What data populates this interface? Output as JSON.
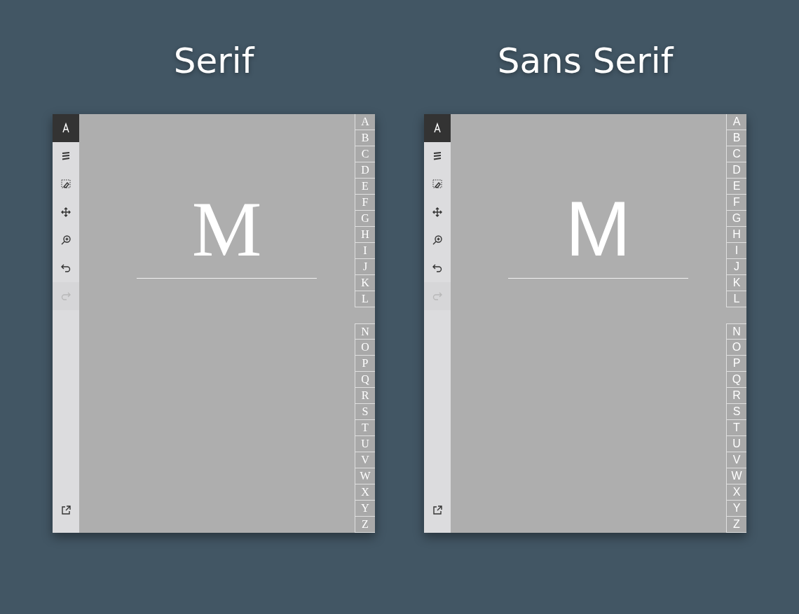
{
  "panels": [
    {
      "title": "Serif",
      "kind": "serif",
      "heading": "M",
      "tools": [
        {
          "kind": "text",
          "selected": true,
          "disabled": false
        },
        {
          "kind": "lines",
          "selected": false,
          "disabled": false
        },
        {
          "kind": "eraser",
          "selected": false,
          "disabled": false
        },
        {
          "kind": "move",
          "selected": false,
          "disabled": false
        },
        {
          "kind": "zoom",
          "selected": false,
          "disabled": false
        },
        {
          "kind": "undo",
          "selected": false,
          "disabled": false
        },
        {
          "kind": "redo",
          "selected": false,
          "disabled": true
        }
      ],
      "bottom_tools": [
        {
          "kind": "export",
          "selected": false,
          "disabled": false
        }
      ],
      "tab_groups": [
        [
          "A",
          "B",
          "C",
          "D",
          "E",
          "F",
          "G",
          "H",
          "I",
          "J",
          "K",
          "L"
        ],
        [
          "N",
          "O",
          "P",
          "Q",
          "R",
          "S",
          "T",
          "U",
          "V",
          "W",
          "X",
          "Y",
          "Z"
        ]
      ]
    },
    {
      "title": "Sans Serif",
      "kind": "sans",
      "heading": "M",
      "tools": [
        {
          "kind": "text",
          "selected": true,
          "disabled": false
        },
        {
          "kind": "lines",
          "selected": false,
          "disabled": false
        },
        {
          "kind": "eraser",
          "selected": false,
          "disabled": false
        },
        {
          "kind": "move",
          "selected": false,
          "disabled": false
        },
        {
          "kind": "zoom",
          "selected": false,
          "disabled": false
        },
        {
          "kind": "undo",
          "selected": false,
          "disabled": false
        },
        {
          "kind": "redo",
          "selected": false,
          "disabled": true
        }
      ],
      "bottom_tools": [
        {
          "kind": "export",
          "selected": false,
          "disabled": false
        }
      ],
      "tab_groups": [
        [
          "A",
          "B",
          "C",
          "D",
          "E",
          "F",
          "G",
          "H",
          "I",
          "J",
          "K",
          "L"
        ],
        [
          "N",
          "O",
          "P",
          "Q",
          "R",
          "S",
          "T",
          "U",
          "V",
          "W",
          "X",
          "Y",
          "Z"
        ]
      ]
    }
  ]
}
